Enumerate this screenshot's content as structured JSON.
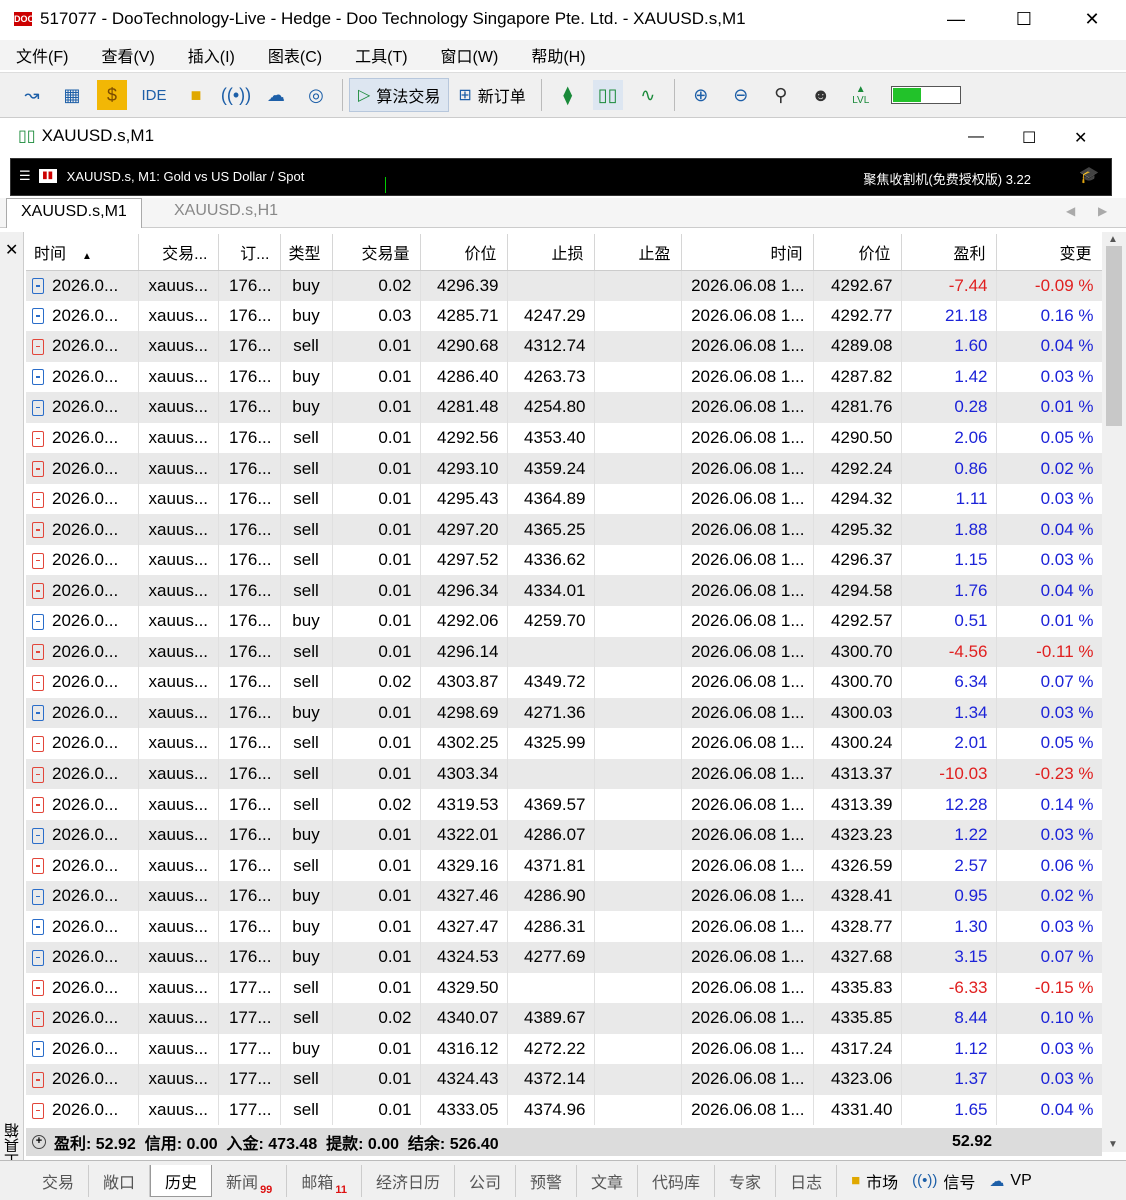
{
  "window": {
    "title": "517077 - DooTechnology-Live - Hedge - Doo Technology Singapore Pte. Ltd. - XAUUSD.s,M1",
    "app_icon_text": "DOO"
  },
  "menu": [
    "文件(F)",
    "查看(V)",
    "插入(I)",
    "图表(C)",
    "工具(T)",
    "窗口(W)",
    "帮助(H)"
  ],
  "toolbar": {
    "ide_label": "IDE",
    "algo_trading": "算法交易",
    "new_order": "新订单",
    "level_label": "LVL",
    "level_fill": 0.42
  },
  "chart_window": {
    "title": "XAUUSD.s,M1",
    "info_left": "XAUUSD.s, M1:  Gold vs US Dollar / Spot",
    "info_right": "聚焦收割机(免费授权版) 3.22",
    "tabs": [
      "XAUUSD.s,M1",
      "XAUUSD.s,H1"
    ]
  },
  "columns": [
    "时间",
    "交易...",
    "订...",
    "类型",
    "交易量",
    "价位",
    "止损",
    "止盈",
    "时间",
    "价位",
    "盈利",
    "变更"
  ],
  "rows": [
    {
      "time": "2026.0...",
      "symbol": "xauus...",
      "order": "176...",
      "type": "buy",
      "volume": "0.02",
      "price": "4296.39",
      "sl": "",
      "tp": "",
      "close_time": "2026.06.08 1...",
      "close_price": "4292.67",
      "profit": "-7.44",
      "change": "-0.09 %"
    },
    {
      "time": "2026.0...",
      "symbol": "xauus...",
      "order": "176...",
      "type": "buy",
      "volume": "0.03",
      "price": "4285.71",
      "sl": "4247.29",
      "tp": "",
      "close_time": "2026.06.08 1...",
      "close_price": "4292.77",
      "profit": "21.18",
      "change": "0.16 %"
    },
    {
      "time": "2026.0...",
      "symbol": "xauus...",
      "order": "176...",
      "type": "sell",
      "volume": "0.01",
      "price": "4290.68",
      "sl": "4312.74",
      "tp": "",
      "close_time": "2026.06.08 1...",
      "close_price": "4289.08",
      "profit": "1.60",
      "change": "0.04 %"
    },
    {
      "time": "2026.0...",
      "symbol": "xauus...",
      "order": "176...",
      "type": "buy",
      "volume": "0.01",
      "price": "4286.40",
      "sl": "4263.73",
      "tp": "",
      "close_time": "2026.06.08 1...",
      "close_price": "4287.82",
      "profit": "1.42",
      "change": "0.03 %"
    },
    {
      "time": "2026.0...",
      "symbol": "xauus...",
      "order": "176...",
      "type": "buy",
      "volume": "0.01",
      "price": "4281.48",
      "sl": "4254.80",
      "tp": "",
      "close_time": "2026.06.08 1...",
      "close_price": "4281.76",
      "profit": "0.28",
      "change": "0.01 %"
    },
    {
      "time": "2026.0...",
      "symbol": "xauus...",
      "order": "176...",
      "type": "sell",
      "volume": "0.01",
      "price": "4292.56",
      "sl": "4353.40",
      "tp": "",
      "close_time": "2026.06.08 1...",
      "close_price": "4290.50",
      "profit": "2.06",
      "change": "0.05 %"
    },
    {
      "time": "2026.0...",
      "symbol": "xauus...",
      "order": "176...",
      "type": "sell",
      "volume": "0.01",
      "price": "4293.10",
      "sl": "4359.24",
      "tp": "",
      "close_time": "2026.06.08 1...",
      "close_price": "4292.24",
      "profit": "0.86",
      "change": "0.02 %"
    },
    {
      "time": "2026.0...",
      "symbol": "xauus...",
      "order": "176...",
      "type": "sell",
      "volume": "0.01",
      "price": "4295.43",
      "sl": "4364.89",
      "tp": "",
      "close_time": "2026.06.08 1...",
      "close_price": "4294.32",
      "profit": "1.11",
      "change": "0.03 %"
    },
    {
      "time": "2026.0...",
      "symbol": "xauus...",
      "order": "176...",
      "type": "sell",
      "volume": "0.01",
      "price": "4297.20",
      "sl": "4365.25",
      "tp": "",
      "close_time": "2026.06.08 1...",
      "close_price": "4295.32",
      "profit": "1.88",
      "change": "0.04 %"
    },
    {
      "time": "2026.0...",
      "symbol": "xauus...",
      "order": "176...",
      "type": "sell",
      "volume": "0.01",
      "price": "4297.52",
      "sl": "4336.62",
      "tp": "",
      "close_time": "2026.06.08 1...",
      "close_price": "4296.37",
      "profit": "1.15",
      "change": "0.03 %"
    },
    {
      "time": "2026.0...",
      "symbol": "xauus...",
      "order": "176...",
      "type": "sell",
      "volume": "0.01",
      "price": "4296.34",
      "sl": "4334.01",
      "tp": "",
      "close_time": "2026.06.08 1...",
      "close_price": "4294.58",
      "profit": "1.76",
      "change": "0.04 %"
    },
    {
      "time": "2026.0...",
      "symbol": "xauus...",
      "order": "176...",
      "type": "buy",
      "volume": "0.01",
      "price": "4292.06",
      "sl": "4259.70",
      "tp": "",
      "close_time": "2026.06.08 1...",
      "close_price": "4292.57",
      "profit": "0.51",
      "change": "0.01 %"
    },
    {
      "time": "2026.0...",
      "symbol": "xauus...",
      "order": "176...",
      "type": "sell",
      "volume": "0.01",
      "price": "4296.14",
      "sl": "",
      "tp": "",
      "close_time": "2026.06.08 1...",
      "close_price": "4300.70",
      "profit": "-4.56",
      "change": "-0.11 %"
    },
    {
      "time": "2026.0...",
      "symbol": "xauus...",
      "order": "176...",
      "type": "sell",
      "volume": "0.02",
      "price": "4303.87",
      "sl": "4349.72",
      "tp": "",
      "close_time": "2026.06.08 1...",
      "close_price": "4300.70",
      "profit": "6.34",
      "change": "0.07 %"
    },
    {
      "time": "2026.0...",
      "symbol": "xauus...",
      "order": "176...",
      "type": "buy",
      "volume": "0.01",
      "price": "4298.69",
      "sl": "4271.36",
      "tp": "",
      "close_time": "2026.06.08 1...",
      "close_price": "4300.03",
      "profit": "1.34",
      "change": "0.03 %"
    },
    {
      "time": "2026.0...",
      "symbol": "xauus...",
      "order": "176...",
      "type": "sell",
      "volume": "0.01",
      "price": "4302.25",
      "sl": "4325.99",
      "tp": "",
      "close_time": "2026.06.08 1...",
      "close_price": "4300.24",
      "profit": "2.01",
      "change": "0.05 %"
    },
    {
      "time": "2026.0...",
      "symbol": "xauus...",
      "order": "176...",
      "type": "sell",
      "volume": "0.01",
      "price": "4303.34",
      "sl": "",
      "tp": "",
      "close_time": "2026.06.08 1...",
      "close_price": "4313.37",
      "profit": "-10.03",
      "change": "-0.23 %"
    },
    {
      "time": "2026.0...",
      "symbol": "xauus...",
      "order": "176...",
      "type": "sell",
      "volume": "0.02",
      "price": "4319.53",
      "sl": "4369.57",
      "tp": "",
      "close_time": "2026.06.08 1...",
      "close_price": "4313.39",
      "profit": "12.28",
      "change": "0.14 %"
    },
    {
      "time": "2026.0...",
      "symbol": "xauus...",
      "order": "176...",
      "type": "buy",
      "volume": "0.01",
      "price": "4322.01",
      "sl": "4286.07",
      "tp": "",
      "close_time": "2026.06.08 1...",
      "close_price": "4323.23",
      "profit": "1.22",
      "change": "0.03 %"
    },
    {
      "time": "2026.0...",
      "symbol": "xauus...",
      "order": "176...",
      "type": "sell",
      "volume": "0.01",
      "price": "4329.16",
      "sl": "4371.81",
      "tp": "",
      "close_time": "2026.06.08 1...",
      "close_price": "4326.59",
      "profit": "2.57",
      "change": "0.06 %"
    },
    {
      "time": "2026.0...",
      "symbol": "xauus...",
      "order": "176...",
      "type": "buy",
      "volume": "0.01",
      "price": "4327.46",
      "sl": "4286.90",
      "tp": "",
      "close_time": "2026.06.08 1...",
      "close_price": "4328.41",
      "profit": "0.95",
      "change": "0.02 %"
    },
    {
      "time": "2026.0...",
      "symbol": "xauus...",
      "order": "176...",
      "type": "buy",
      "volume": "0.01",
      "price": "4327.47",
      "sl": "4286.31",
      "tp": "",
      "close_time": "2026.06.08 1...",
      "close_price": "4328.77",
      "profit": "1.30",
      "change": "0.03 %"
    },
    {
      "time": "2026.0...",
      "symbol": "xauus...",
      "order": "176...",
      "type": "buy",
      "volume": "0.01",
      "price": "4324.53",
      "sl": "4277.69",
      "tp": "",
      "close_time": "2026.06.08 1...",
      "close_price": "4327.68",
      "profit": "3.15",
      "change": "0.07 %"
    },
    {
      "time": "2026.0...",
      "symbol": "xauus...",
      "order": "177...",
      "type": "sell",
      "volume": "0.01",
      "price": "4329.50",
      "sl": "",
      "tp": "",
      "close_time": "2026.06.08 1...",
      "close_price": "4335.83",
      "profit": "-6.33",
      "change": "-0.15 %"
    },
    {
      "time": "2026.0...",
      "symbol": "xauus...",
      "order": "177...",
      "type": "sell",
      "volume": "0.02",
      "price": "4340.07",
      "sl": "4389.67",
      "tp": "",
      "close_time": "2026.06.08 1...",
      "close_price": "4335.85",
      "profit": "8.44",
      "change": "0.10 %"
    },
    {
      "time": "2026.0...",
      "symbol": "xauus...",
      "order": "177...",
      "type": "buy",
      "volume": "0.01",
      "price": "4316.12",
      "sl": "4272.22",
      "tp": "",
      "close_time": "2026.06.08 1...",
      "close_price": "4317.24",
      "profit": "1.12",
      "change": "0.03 %"
    },
    {
      "time": "2026.0...",
      "symbol": "xauus...",
      "order": "177...",
      "type": "sell",
      "volume": "0.01",
      "price": "4324.43",
      "sl": "4372.14",
      "tp": "",
      "close_time": "2026.06.08 1...",
      "close_price": "4323.06",
      "profit": "1.37",
      "change": "0.03 %"
    },
    {
      "time": "2026.0...",
      "symbol": "xauus...",
      "order": "177...",
      "type": "sell",
      "volume": "0.01",
      "price": "4333.05",
      "sl": "4374.96",
      "tp": "",
      "close_time": "2026.06.08 1...",
      "close_price": "4331.40",
      "profit": "1.65",
      "change": "0.04 %"
    }
  ],
  "summary": {
    "text": "盈利: 52.92  信用: 0.00  入金: 473.48  提款: 0.00  结余: 526.40",
    "total": "52.92"
  },
  "toolbox_label": "工具箱",
  "bottom_tabs": [
    {
      "label": "交易",
      "badge": ""
    },
    {
      "label": "敞口",
      "badge": ""
    },
    {
      "label": "历史",
      "badge": "",
      "active": true
    },
    {
      "label": "新闻",
      "badge": "99"
    },
    {
      "label": "邮箱",
      "badge": "11"
    },
    {
      "label": "经济日历",
      "badge": ""
    },
    {
      "label": "公司",
      "badge": ""
    },
    {
      "label": "预警",
      "badge": ""
    },
    {
      "label": "文章",
      "badge": ""
    },
    {
      "label": "代码库",
      "badge": ""
    },
    {
      "label": "专家",
      "badge": ""
    },
    {
      "label": "日志",
      "badge": ""
    }
  ],
  "bottom_right": [
    "市场",
    "信号",
    "VP"
  ],
  "colors": {
    "profit_pos": "#1c23d8",
    "profit_neg": "#e02020",
    "buy_icon": "#2a6dc9",
    "sell_icon": "#e2463a"
  }
}
